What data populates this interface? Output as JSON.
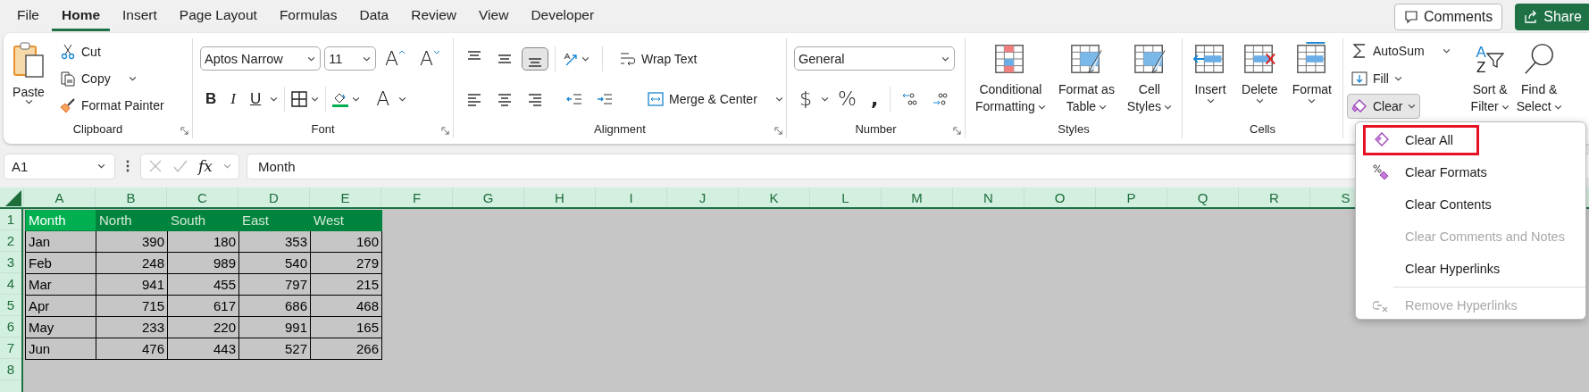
{
  "menu_tabs": [
    {
      "label": "File",
      "selected": false
    },
    {
      "label": "Home",
      "selected": true
    },
    {
      "label": "Insert",
      "selected": false
    },
    {
      "label": "Page Layout",
      "selected": false
    },
    {
      "label": "Formulas",
      "selected": false
    },
    {
      "label": "Data",
      "selected": false
    },
    {
      "label": "Review",
      "selected": false
    },
    {
      "label": "View",
      "selected": false
    },
    {
      "label": "Developer",
      "selected": false
    }
  ],
  "header_buttons": {
    "comments": "Comments",
    "share": "Share"
  },
  "ribbon": {
    "clipboard": {
      "label": "Clipboard",
      "paste": "Paste",
      "cut": "Cut",
      "copy": "Copy",
      "format_painter": "Format Painter"
    },
    "font": {
      "label": "Font",
      "font_name": "Aptos Narrow",
      "font_size": "11",
      "grow": "A",
      "shrink": "A",
      "bold": "B",
      "italic": "I",
      "underline": "U",
      "font_color": "A"
    },
    "alignment": {
      "label": "Alignment",
      "vertical": [
        {
          "selected": false
        },
        {
          "selected": false
        },
        {
          "selected": true
        }
      ],
      "wrap_text": "Wrap Text",
      "merge_center": "Merge & Center"
    },
    "number": {
      "label": "Number",
      "format": "General",
      "currency": "$",
      "percent": "%",
      "comma": ","
    },
    "styles": {
      "label": "Styles",
      "buttons": [
        {
          "kind": "conditional",
          "lines": [
            "Conditional",
            "Formatting"
          ]
        },
        {
          "kind": "table",
          "lines": [
            "Format as",
            "Table"
          ]
        },
        {
          "kind": "cell_styles",
          "lines": [
            "Cell",
            "Styles"
          ]
        }
      ]
    },
    "cells": {
      "label": "Cells",
      "buttons": [
        {
          "kind": "insert",
          "lines": [
            "Insert"
          ]
        },
        {
          "kind": "delete",
          "lines": [
            "Delete"
          ]
        },
        {
          "kind": "format",
          "lines": [
            "Format"
          ]
        }
      ]
    },
    "editing": {
      "autosum": "AutoSum",
      "fill": "Fill",
      "clear": "Clear",
      "clear_expanded": true,
      "sort_letters": [
        "A",
        "Z"
      ],
      "sort_filter": [
        "Sort &",
        "Filter"
      ],
      "find_select": [
        "Find &",
        "Select"
      ]
    }
  },
  "formula_bar": {
    "name_box": "A1",
    "fx": "fx",
    "formula": "Month"
  },
  "sheet": {
    "columns": [
      "A",
      "B",
      "C",
      "D",
      "E",
      "F",
      "G",
      "H",
      "I",
      "J",
      "K",
      "L",
      "M",
      "N",
      "O",
      "P",
      "Q",
      "R",
      "S"
    ],
    "row_numbers": [
      "1",
      "2",
      "3",
      "4",
      "5",
      "6",
      "7",
      "8"
    ],
    "header": [
      {
        "text": "Month",
        "active": true
      },
      {
        "text": "North",
        "active": false
      },
      {
        "text": "South",
        "active": false
      },
      {
        "text": "East",
        "active": false
      },
      {
        "text": "West",
        "active": false
      }
    ],
    "rows": [
      [
        "Jan",
        "390",
        "180",
        "353",
        "160"
      ],
      [
        "Feb",
        "248",
        "989",
        "540",
        "279"
      ],
      [
        "Mar",
        "941",
        "455",
        "797",
        "215"
      ],
      [
        "Apr",
        "715",
        "617",
        "686",
        "468"
      ],
      [
        "May",
        "233",
        "220",
        "991",
        "165"
      ],
      [
        "Jun",
        "476",
        "443",
        "527",
        "266"
      ]
    ]
  },
  "clear_menu": {
    "items": [
      {
        "kind": "eraser",
        "label": "Clear All",
        "disabled": false,
        "highlighted": true
      },
      {
        "kind": "format_eraser",
        "label": "Clear Formats",
        "disabled": false,
        "highlighted": false
      },
      {
        "kind": "plain",
        "label": "Clear Contents",
        "disabled": false,
        "highlighted": false
      },
      {
        "kind": "plain",
        "label": "Clear Comments and Notes",
        "disabled": true,
        "highlighted": false
      },
      {
        "kind": "plain",
        "label": "Clear Hyperlinks",
        "disabled": false,
        "highlighted": false
      },
      {
        "kind": "separator"
      },
      {
        "kind": "unlink",
        "label": "Remove Hyperlinks",
        "disabled": true,
        "highlighted": false
      }
    ]
  }
}
